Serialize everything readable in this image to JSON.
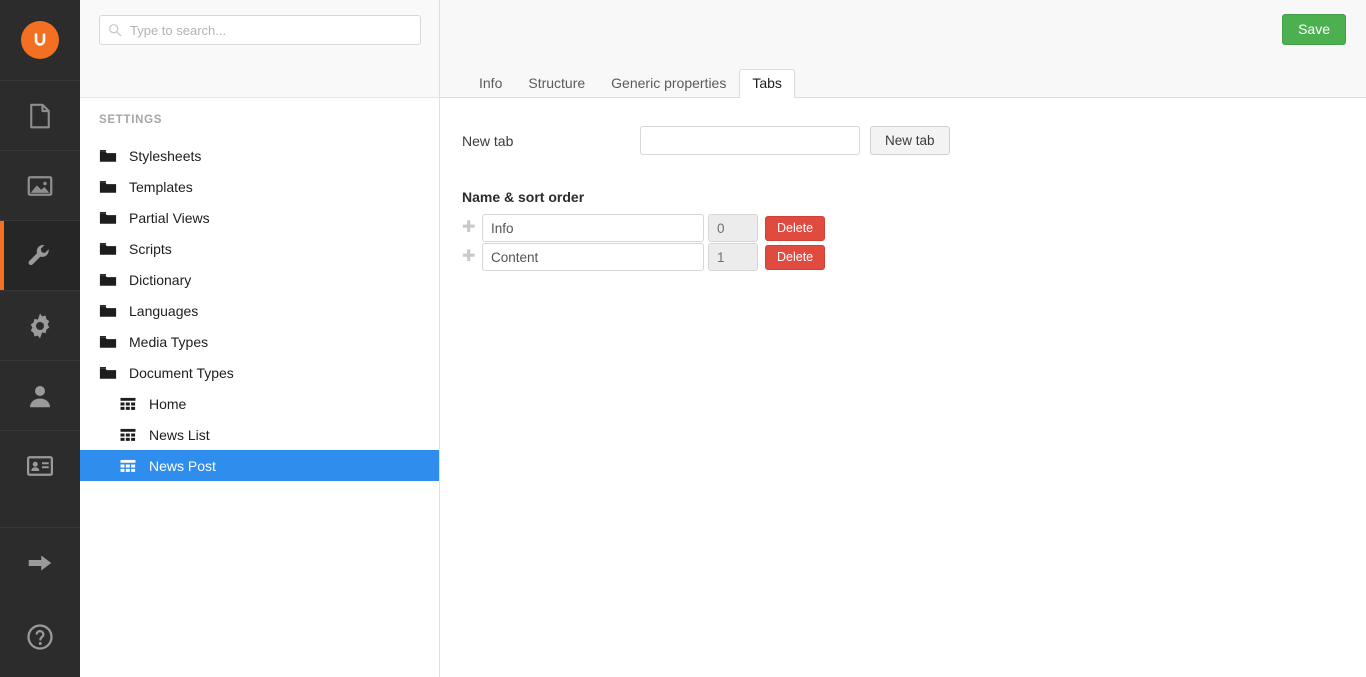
{
  "colors": {
    "brand_orange": "#f36f21",
    "nav_background": "#2c2c2c",
    "selection_blue": "#2e8ded",
    "save_green": "#4caf50",
    "delete_red": "#e04a3f"
  },
  "appnav": {
    "logo_name": "umbraco-logo",
    "items": [
      {
        "icon": "content-document-icon",
        "label": "Content",
        "active": false
      },
      {
        "icon": "media-image-icon",
        "label": "Media",
        "active": false
      },
      {
        "icon": "settings-wrench-icon",
        "label": "Settings",
        "active": true
      },
      {
        "icon": "developer-gear-icon",
        "label": "Developer",
        "active": false
      },
      {
        "icon": "users-person-icon",
        "label": "Users",
        "active": false
      },
      {
        "icon": "members-idcard-icon",
        "label": "Members",
        "active": false
      },
      {
        "icon": "logout-arrow-icon",
        "label": "Logout",
        "active": false
      },
      {
        "icon": "help-question-icon",
        "label": "Help",
        "active": false
      }
    ]
  },
  "search": {
    "placeholder": "Type to search...",
    "value": "",
    "icon": "search-icon"
  },
  "tree": {
    "title": "SETTINGS",
    "items": [
      {
        "label": "Stylesheets",
        "icon": "folder-icon",
        "child": false,
        "selected": false
      },
      {
        "label": "Templates",
        "icon": "folder-icon",
        "child": false,
        "selected": false
      },
      {
        "label": "Partial Views",
        "icon": "folder-icon",
        "child": false,
        "selected": false
      },
      {
        "label": "Scripts",
        "icon": "folder-icon",
        "child": false,
        "selected": false
      },
      {
        "label": "Dictionary",
        "icon": "folder-icon",
        "child": false,
        "selected": false
      },
      {
        "label": "Languages",
        "icon": "folder-icon",
        "child": false,
        "selected": false
      },
      {
        "label": "Media Types",
        "icon": "folder-icon",
        "child": false,
        "selected": false
      },
      {
        "label": "Document Types",
        "icon": "folder-icon",
        "child": false,
        "selected": false
      },
      {
        "label": "Home",
        "icon": "doctype-grid-icon",
        "child": true,
        "selected": false
      },
      {
        "label": "News List",
        "icon": "doctype-grid-icon",
        "child": true,
        "selected": false
      },
      {
        "label": "News Post",
        "icon": "doctype-grid-icon",
        "child": true,
        "selected": true
      }
    ]
  },
  "header": {
    "save_label": "Save"
  },
  "tabs": [
    {
      "label": "Info",
      "active": false
    },
    {
      "label": "Structure",
      "active": false
    },
    {
      "label": "Generic properties",
      "active": false
    },
    {
      "label": "Tabs",
      "active": true
    }
  ],
  "editor": {
    "new_tab_label": "New tab",
    "new_tab_input_value": "",
    "new_tab_input_placeholder": "",
    "new_tab_button_label": "New tab",
    "group_title": "Name & sort order",
    "delete_label": "Delete",
    "handle_icon": "drag-handle-icon",
    "rows": [
      {
        "name": "Info",
        "sort_order": "0"
      },
      {
        "name": "Content",
        "sort_order": "1"
      }
    ]
  }
}
